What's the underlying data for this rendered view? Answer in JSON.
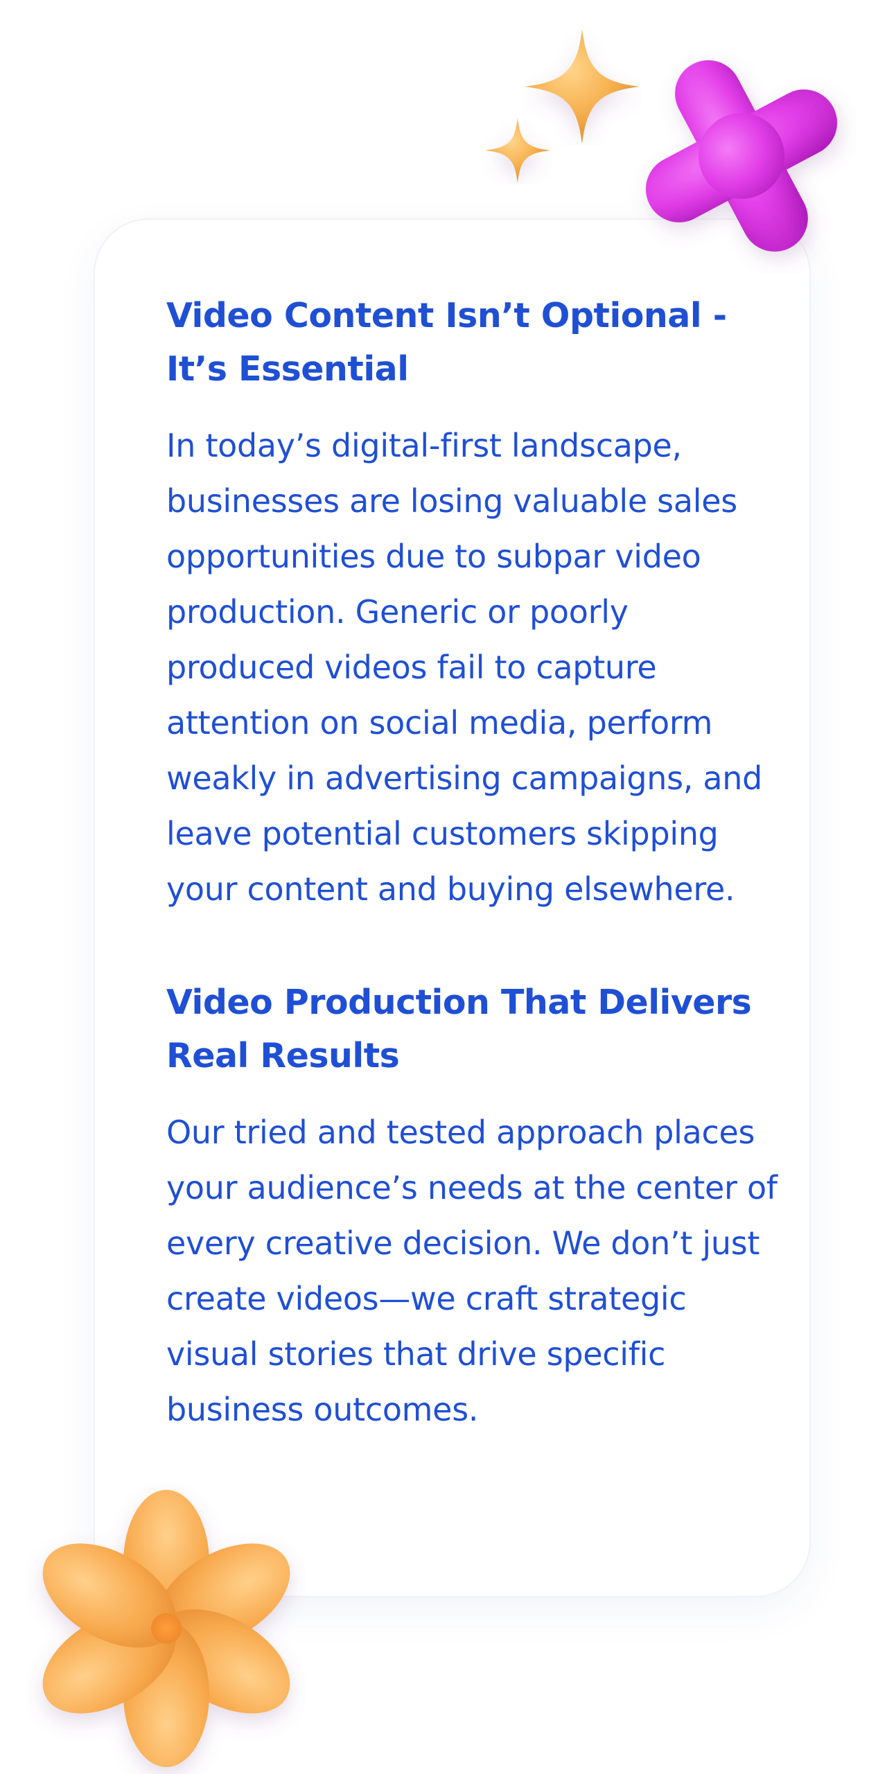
{
  "theme": {
    "text_color": "#1f4fd4",
    "star_color": "#f6b04f",
    "cross_color": "#e23ee8",
    "flower_color": "#f8a94d"
  },
  "decorations": {
    "star_large": "sparkle-icon",
    "star_small": "sparkle-icon",
    "cross": "cross-shape-icon",
    "flower": "flower-icon"
  },
  "sections": [
    {
      "heading": "Video Content Isn’t Optional - It’s Essential",
      "body": "In today’s digital-first landscape, businesses are losing valuable sales opportunities due to subpar video production. Generic or poorly produced videos fail to capture attention on social media, perform weakly in advertising campaigns, and leave potential customers skipping your content and buying elsewhere."
    },
    {
      "heading": "Video Production That Delivers Real Results",
      "body": "Our tried and tested approach places your audience’s needs at the center of every creative decision. We don’t just create videos—we craft strategic visual stories that drive specific business outcomes."
    }
  ]
}
